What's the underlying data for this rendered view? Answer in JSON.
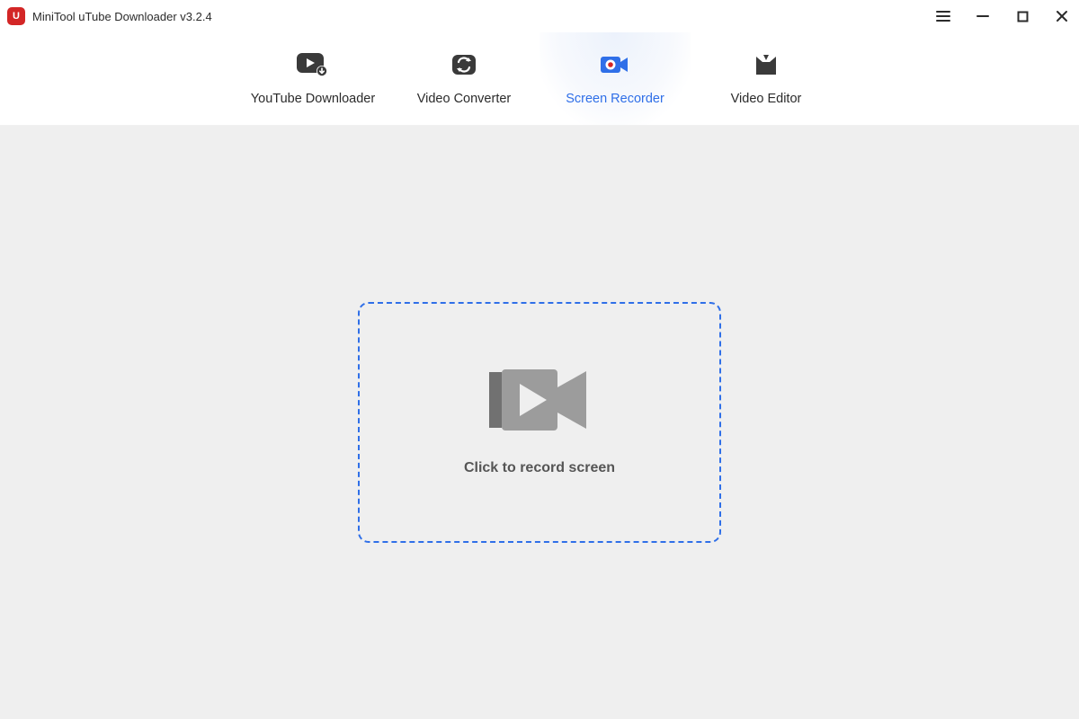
{
  "app": {
    "title": "MiniTool uTube Downloader v3.2.4"
  },
  "tabs": {
    "youtube": "YouTube Downloader",
    "converter": "Video Converter",
    "recorder": "Screen Recorder",
    "editor": "Video Editor"
  },
  "main": {
    "record_cta": "Click to record screen"
  }
}
